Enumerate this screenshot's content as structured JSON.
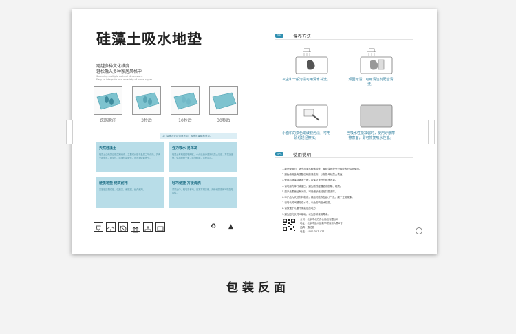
{
  "product": {
    "title": "硅藻土吸水地垫",
    "subtitle_line1": "跨越多种文化维度",
    "subtitle_line2": "轻松融入多种家居风格中",
    "subtitle_en_line1": "Spanning multiple cultural dimensions",
    "subtitle_en_line2": "Easy to integrate into a variety of home styles"
  },
  "absorb_demo": {
    "steps": [
      {
        "label": "踩踏瞬间"
      },
      {
        "label": "3秒后"
      },
      {
        "label": "10秒后"
      },
      {
        "label": "30秒后"
      }
    ],
    "hint": "注：温度及环境湿度不同，吸水效果略有差异。"
  },
  "features": [
    {
      "title": "天然硅藻土",
      "text": "硅藻土由硅藻遗骸沉积而成，主要成分是非晶质二氧化硅，具有无数微孔，吸湿性、防潮性能极佳，可迅速吸收水分。"
    },
    {
      "title": "强力吸水 易挥发",
      "text": "硅藻土有较强的吸附性，水分迅速渗透到硅藻土内部，挥发速度快，保持地面干爽，防滑耐用，方便省心。"
    },
    {
      "title": "硬质地垫 结实耐用",
      "text": "高密度压制成型，强度高，耐磨损，经久耐用。"
    },
    {
      "title": "轻巧便捷 方便清洗",
      "text": "重量适中，轻巧易移动，日常打理方便，用砂纸打磨即可恢复吸水性。"
    }
  ],
  "care": {
    "badge": "TIPS",
    "title": "保养方法",
    "items": [
      {
        "caption": "灰尘和一般污渍可用清水冲洗。"
      },
      {
        "caption": "顽固污渍，可用清洁剂配合清洗。"
      },
      {
        "caption": "小面积的染色或破裂污渍，可用砂纸轻轻擦拭。"
      },
      {
        "caption": "当吸水性能减弱时，使用砂纸摩擦表面，即可恢复吸水性能。"
      }
    ]
  },
  "usage": {
    "badge": "TIPS",
    "title": "使用说明",
    "steps": [
      "1.新品使用时，请先用清水轻微冲洗，使硅藻地垫充分吸收水分后再使用。",
      "2.避免使用含有强酸强碱的清洁剂，以免损坏硅藻土表面。",
      "3.使用后请保持通风干燥，以保证良好的吸水效果。",
      "4.请勿用力摔打或重压，避免剧烈碰撞造成断裂、破损。",
      "5.如产品表面沾有污渍，可用细砂纸轻轻打磨去除。",
      "6.本产品为天然材料制成，表面可能存在细小气孔，属于正常现象。",
      "7.请勿长时间浸泡在水中，以免影响吸水性能。",
      "8.请放置于儿童不易触及的地方。",
      "9.避免阳光长时间暴晒，以免影响使用寿命。"
    ]
  },
  "company": {
    "maker": "公司：北京市北方办公用品有限公司",
    "address": "地址：北京市通州区新华联商务大厦8号",
    "brand": "品牌：通达雅",
    "phone": "电话：4000-307-477"
  },
  "caption": "包装反面"
}
